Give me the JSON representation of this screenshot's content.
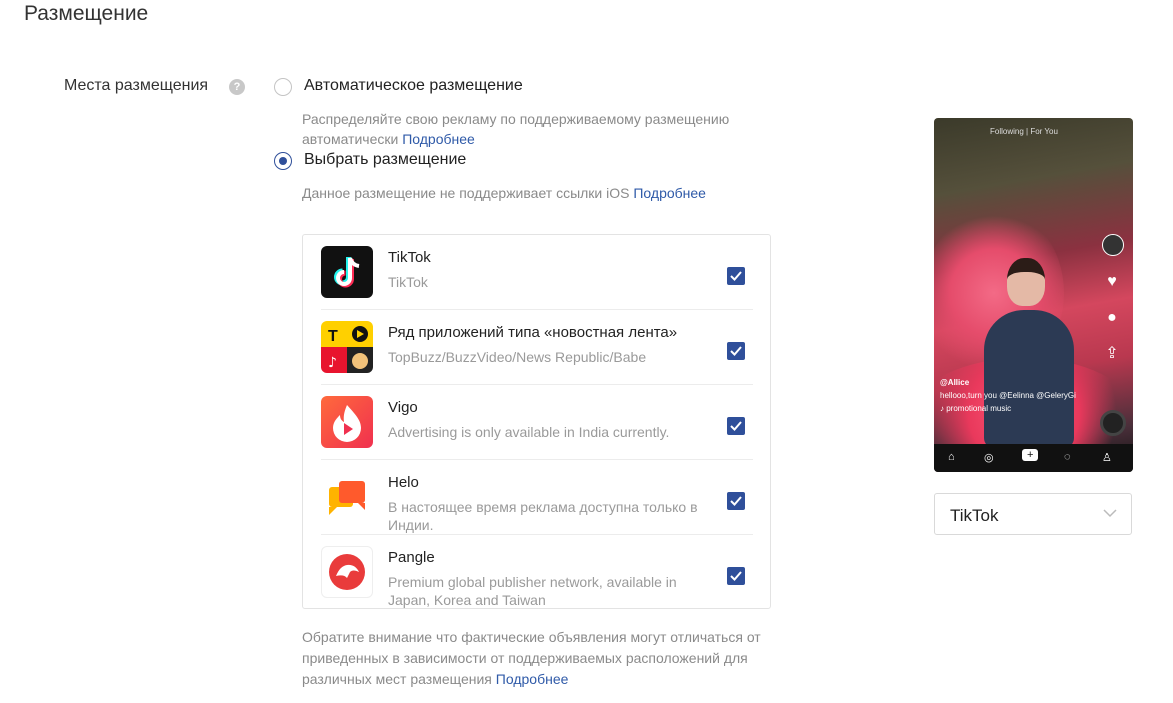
{
  "section": {
    "title": "Размещение"
  },
  "placement": {
    "label": "Места размещения",
    "help_icon": "?",
    "options": [
      {
        "label": "Автоматическое размещение",
        "hint": "Распределяйте свою рекламу по поддерживаемому размещению автоматически",
        "link": "Подробнее",
        "selected": false
      },
      {
        "label": "Выбрать размещение",
        "hint": "Данное размещение не поддерживает ссылки iOS",
        "link": "Подробнее",
        "selected": true
      }
    ],
    "apps": [
      {
        "icon": "tiktok-icon",
        "title": "TikTok",
        "subtitle": "TikTok",
        "checked": true
      },
      {
        "icon": "news-feed-apps-icon",
        "title": "Ряд приложений типа «новостная лента»",
        "subtitle": "TopBuzz/BuzzVideo/News Republic/Babe",
        "checked": true
      },
      {
        "icon": "vigo-icon",
        "title": "Vigo",
        "subtitle": "Advertising is only available in India currently.",
        "checked": true
      },
      {
        "icon": "helo-icon",
        "title": "Helo",
        "subtitle": "В настоящее время реклама доступна только в Индии.",
        "checked": true
      },
      {
        "icon": "pangle-icon",
        "title": "Pangle",
        "subtitle": "Premium global publisher network, available in Japan, Korea and Taiwan",
        "checked": true
      }
    ],
    "footer_note": "Обратите внимание что фактические объявления могут отличаться от приведенных в зависимости от поддерживаемых расположений для различных мест размещения",
    "footer_link": "Подробнее"
  },
  "preview": {
    "topnav": "Following  |  For You",
    "caption_user": "@Allice",
    "caption_text": "hellooo,turn you @Eelinna @GeleryGi",
    "caption_music": "♪ promotional music",
    "select": {
      "value": "TikTok"
    }
  },
  "colors": {
    "accent": "#2f4f9a",
    "link": "#2f5aa8"
  }
}
